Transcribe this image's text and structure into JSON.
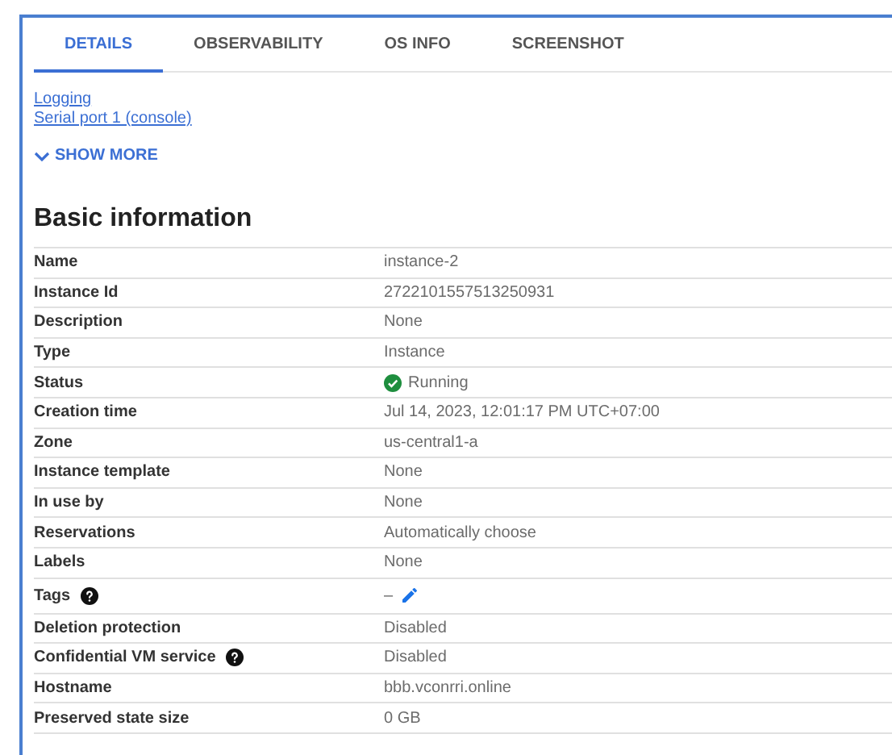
{
  "tabs": [
    {
      "label": "DETAILS",
      "selected": true
    },
    {
      "label": "OBSERVABILITY",
      "selected": false
    },
    {
      "label": "OS INFO",
      "selected": false
    },
    {
      "label": "SCREENSHOT",
      "selected": false
    }
  ],
  "links": [
    "Logging",
    "Serial port 1 (console)"
  ],
  "show_more": {
    "label": "SHOW MORE",
    "expanded": false
  },
  "section_title": "Basic information",
  "rows": [
    {
      "label": "Name",
      "help": false,
      "kind": "text",
      "value": "instance-2"
    },
    {
      "label": "Instance Id",
      "help": false,
      "kind": "text",
      "value": "2722101557513250931"
    },
    {
      "label": "Description",
      "help": false,
      "kind": "text",
      "value": "None"
    },
    {
      "label": "Type",
      "help": false,
      "kind": "text",
      "value": "Instance"
    },
    {
      "label": "Status",
      "help": false,
      "kind": "status",
      "value": "Running"
    },
    {
      "label": "Creation time",
      "help": false,
      "kind": "text",
      "value": "Jul 14, 2023, 12:01:17 PM UTC+07:00"
    },
    {
      "label": "Zone",
      "help": false,
      "kind": "text",
      "value": "us-central1-a"
    },
    {
      "label": "Instance template",
      "help": false,
      "kind": "text",
      "value": "None"
    },
    {
      "label": "In use by",
      "help": false,
      "kind": "text",
      "value": "None"
    },
    {
      "label": "Reservations",
      "help": false,
      "kind": "text",
      "value": "Automatically choose"
    },
    {
      "label": "Labels",
      "help": false,
      "kind": "text",
      "value": "None"
    },
    {
      "label": "Tags",
      "help": true,
      "kind": "editable",
      "value": "–"
    },
    {
      "label": "Deletion protection",
      "help": false,
      "kind": "text",
      "value": "Disabled"
    },
    {
      "label": "Confidential VM service",
      "help": true,
      "kind": "text",
      "value": "Disabled"
    },
    {
      "label": "Hostname",
      "help": false,
      "kind": "text",
      "value": "bbb.vconrri.online"
    },
    {
      "label": "Preserved state size",
      "help": false,
      "kind": "text",
      "value": "0 GB"
    }
  ]
}
